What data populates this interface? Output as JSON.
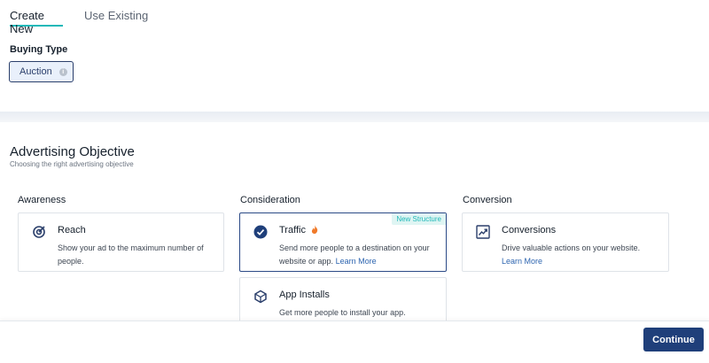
{
  "tabs": [
    {
      "label": "Create New",
      "active": true
    },
    {
      "label": "Use Existing",
      "active": false
    }
  ],
  "buying_type": {
    "label": "Buying Type",
    "selected": "Auction",
    "info_icon": "info-icon"
  },
  "objective": {
    "title": "Advertising Objective",
    "subtitle": "Choosing the right advertising objective"
  },
  "columns": [
    {
      "label": "Awareness"
    },
    {
      "label": "Consideration"
    },
    {
      "label": "Conversion"
    }
  ],
  "cards": {
    "reach": {
      "title": "Reach",
      "desc": "Show your ad to the maximum number of people.",
      "icon": "target-icon"
    },
    "traffic": {
      "title": "Traffic",
      "desc": "Send more people to a destination on your website or app.",
      "link": "Learn More",
      "badge": "New Structure",
      "icon": "check-circle-icon",
      "hot_icon": "fire-icon",
      "selected": true
    },
    "app_installs": {
      "title": "App Installs",
      "desc": "Get more people to install your app.",
      "icon": "cube-icon"
    },
    "conversions": {
      "title": "Conversions",
      "desc": "Drive valuable actions on your website.",
      "link": "Learn More",
      "icon": "trend-up-icon"
    }
  },
  "footer": {
    "continue_label": "Continue"
  },
  "colors": {
    "accent": "#1fb8b8",
    "primary": "#1f3f7a",
    "link": "#2e65b0"
  }
}
